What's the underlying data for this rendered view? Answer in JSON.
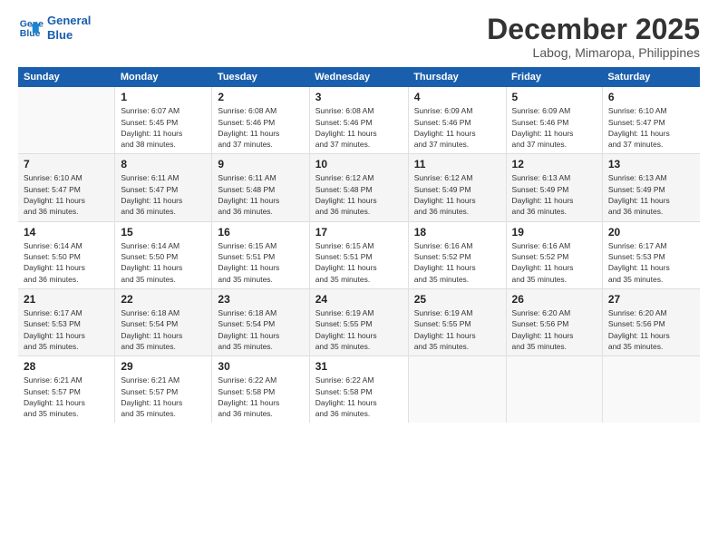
{
  "logo": {
    "line1": "General",
    "line2": "Blue"
  },
  "title": "December 2025",
  "subtitle": "Labog, Mimaropa, Philippines",
  "days_header": [
    "Sunday",
    "Monday",
    "Tuesday",
    "Wednesday",
    "Thursday",
    "Friday",
    "Saturday"
  ],
  "weeks": [
    [
      {
        "num": "",
        "sunrise": "",
        "sunset": "",
        "daylight": ""
      },
      {
        "num": "1",
        "sunrise": "Sunrise: 6:07 AM",
        "sunset": "Sunset: 5:45 PM",
        "daylight": "Daylight: 11 hours and 38 minutes."
      },
      {
        "num": "2",
        "sunrise": "Sunrise: 6:08 AM",
        "sunset": "Sunset: 5:46 PM",
        "daylight": "Daylight: 11 hours and 37 minutes."
      },
      {
        "num": "3",
        "sunrise": "Sunrise: 6:08 AM",
        "sunset": "Sunset: 5:46 PM",
        "daylight": "Daylight: 11 hours and 37 minutes."
      },
      {
        "num": "4",
        "sunrise": "Sunrise: 6:09 AM",
        "sunset": "Sunset: 5:46 PM",
        "daylight": "Daylight: 11 hours and 37 minutes."
      },
      {
        "num": "5",
        "sunrise": "Sunrise: 6:09 AM",
        "sunset": "Sunset: 5:46 PM",
        "daylight": "Daylight: 11 hours and 37 minutes."
      },
      {
        "num": "6",
        "sunrise": "Sunrise: 6:10 AM",
        "sunset": "Sunset: 5:47 PM",
        "daylight": "Daylight: 11 hours and 37 minutes."
      }
    ],
    [
      {
        "num": "7",
        "sunrise": "Sunrise: 6:10 AM",
        "sunset": "Sunset: 5:47 PM",
        "daylight": "Daylight: 11 hours and 36 minutes."
      },
      {
        "num": "8",
        "sunrise": "Sunrise: 6:11 AM",
        "sunset": "Sunset: 5:47 PM",
        "daylight": "Daylight: 11 hours and 36 minutes."
      },
      {
        "num": "9",
        "sunrise": "Sunrise: 6:11 AM",
        "sunset": "Sunset: 5:48 PM",
        "daylight": "Daylight: 11 hours and 36 minutes."
      },
      {
        "num": "10",
        "sunrise": "Sunrise: 6:12 AM",
        "sunset": "Sunset: 5:48 PM",
        "daylight": "Daylight: 11 hours and 36 minutes."
      },
      {
        "num": "11",
        "sunrise": "Sunrise: 6:12 AM",
        "sunset": "Sunset: 5:49 PM",
        "daylight": "Daylight: 11 hours and 36 minutes."
      },
      {
        "num": "12",
        "sunrise": "Sunrise: 6:13 AM",
        "sunset": "Sunset: 5:49 PM",
        "daylight": "Daylight: 11 hours and 36 minutes."
      },
      {
        "num": "13",
        "sunrise": "Sunrise: 6:13 AM",
        "sunset": "Sunset: 5:49 PM",
        "daylight": "Daylight: 11 hours and 36 minutes."
      }
    ],
    [
      {
        "num": "14",
        "sunrise": "Sunrise: 6:14 AM",
        "sunset": "Sunset: 5:50 PM",
        "daylight": "Daylight: 11 hours and 36 minutes."
      },
      {
        "num": "15",
        "sunrise": "Sunrise: 6:14 AM",
        "sunset": "Sunset: 5:50 PM",
        "daylight": "Daylight: 11 hours and 35 minutes."
      },
      {
        "num": "16",
        "sunrise": "Sunrise: 6:15 AM",
        "sunset": "Sunset: 5:51 PM",
        "daylight": "Daylight: 11 hours and 35 minutes."
      },
      {
        "num": "17",
        "sunrise": "Sunrise: 6:15 AM",
        "sunset": "Sunset: 5:51 PM",
        "daylight": "Daylight: 11 hours and 35 minutes."
      },
      {
        "num": "18",
        "sunrise": "Sunrise: 6:16 AM",
        "sunset": "Sunset: 5:52 PM",
        "daylight": "Daylight: 11 hours and 35 minutes."
      },
      {
        "num": "19",
        "sunrise": "Sunrise: 6:16 AM",
        "sunset": "Sunset: 5:52 PM",
        "daylight": "Daylight: 11 hours and 35 minutes."
      },
      {
        "num": "20",
        "sunrise": "Sunrise: 6:17 AM",
        "sunset": "Sunset: 5:53 PM",
        "daylight": "Daylight: 11 hours and 35 minutes."
      }
    ],
    [
      {
        "num": "21",
        "sunrise": "Sunrise: 6:17 AM",
        "sunset": "Sunset: 5:53 PM",
        "daylight": "Daylight: 11 hours and 35 minutes."
      },
      {
        "num": "22",
        "sunrise": "Sunrise: 6:18 AM",
        "sunset": "Sunset: 5:54 PM",
        "daylight": "Daylight: 11 hours and 35 minutes."
      },
      {
        "num": "23",
        "sunrise": "Sunrise: 6:18 AM",
        "sunset": "Sunset: 5:54 PM",
        "daylight": "Daylight: 11 hours and 35 minutes."
      },
      {
        "num": "24",
        "sunrise": "Sunrise: 6:19 AM",
        "sunset": "Sunset: 5:55 PM",
        "daylight": "Daylight: 11 hours and 35 minutes."
      },
      {
        "num": "25",
        "sunrise": "Sunrise: 6:19 AM",
        "sunset": "Sunset: 5:55 PM",
        "daylight": "Daylight: 11 hours and 35 minutes."
      },
      {
        "num": "26",
        "sunrise": "Sunrise: 6:20 AM",
        "sunset": "Sunset: 5:56 PM",
        "daylight": "Daylight: 11 hours and 35 minutes."
      },
      {
        "num": "27",
        "sunrise": "Sunrise: 6:20 AM",
        "sunset": "Sunset: 5:56 PM",
        "daylight": "Daylight: 11 hours and 35 minutes."
      }
    ],
    [
      {
        "num": "28",
        "sunrise": "Sunrise: 6:21 AM",
        "sunset": "Sunset: 5:57 PM",
        "daylight": "Daylight: 11 hours and 35 minutes."
      },
      {
        "num": "29",
        "sunrise": "Sunrise: 6:21 AM",
        "sunset": "Sunset: 5:57 PM",
        "daylight": "Daylight: 11 hours and 35 minutes."
      },
      {
        "num": "30",
        "sunrise": "Sunrise: 6:22 AM",
        "sunset": "Sunset: 5:58 PM",
        "daylight": "Daylight: 11 hours and 36 minutes."
      },
      {
        "num": "31",
        "sunrise": "Sunrise: 6:22 AM",
        "sunset": "Sunset: 5:58 PM",
        "daylight": "Daylight: 11 hours and 36 minutes."
      },
      {
        "num": "",
        "sunrise": "",
        "sunset": "",
        "daylight": ""
      },
      {
        "num": "",
        "sunrise": "",
        "sunset": "",
        "daylight": ""
      },
      {
        "num": "",
        "sunrise": "",
        "sunset": "",
        "daylight": ""
      }
    ]
  ]
}
